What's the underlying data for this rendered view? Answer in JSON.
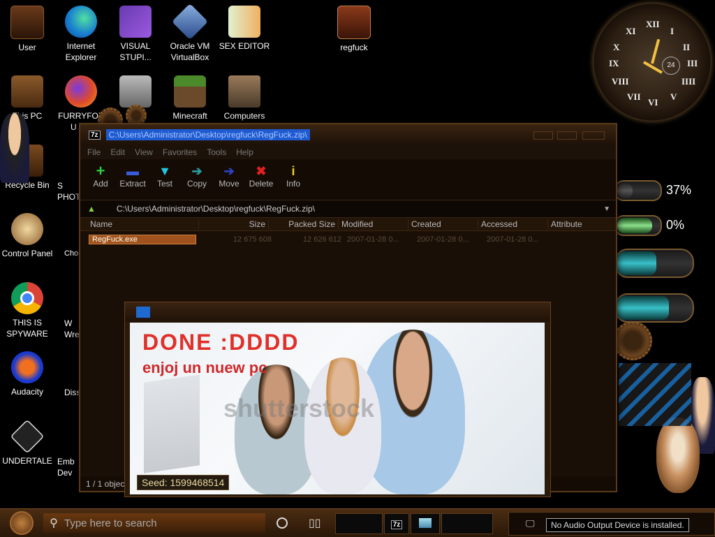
{
  "desktop": {
    "icons": [
      {
        "label": "User"
      },
      {
        "label": "Internet Explorer"
      },
      {
        "label": "VISUAL STUPI..."
      },
      {
        "label": "Oracle VM VirtualBox"
      },
      {
        "label": "SEX EDITOR"
      },
      {
        "label": "regfuck"
      },
      {
        "label": "This PC"
      },
      {
        "label": "FURRYFOX"
      },
      {
        "label": "Minecraft"
      },
      {
        "label": "Computers"
      },
      {
        "label": "Recycle Bin"
      },
      {
        "label": "Control Panel"
      },
      {
        "label": "THIS IS SPYWARE"
      },
      {
        "label": "Audacity"
      },
      {
        "label": "UNDERTALE"
      }
    ],
    "partial_labels": {
      "photo": "S PHOT",
      "chrome": "Chom",
      "wre": "W Wre",
      "dis": "Diss",
      "emb": "Emb Dev",
      "fox2": "U"
    }
  },
  "clock": {
    "numerals": [
      "XII",
      "I",
      "II",
      "III",
      "IIII",
      "V",
      "VI",
      "VII",
      "VIII",
      "IX",
      "X",
      "XI"
    ],
    "subdial": "24"
  },
  "window_7z": {
    "title": "C:\\Users\\Administrator\\Desktop\\regfuck\\RegFuck.zip\\",
    "app_badge": "7z",
    "menu": [
      "File",
      "Edit",
      "View",
      "Favorites",
      "Tools",
      "Help"
    ],
    "toolbar": [
      {
        "label": "Add",
        "glyph": "+",
        "color": "#2ecc40"
      },
      {
        "label": "Extract",
        "glyph": "▬",
        "color": "#3a5ad8"
      },
      {
        "label": "Test",
        "glyph": "▼",
        "color": "#22c8e0"
      },
      {
        "label": "Copy",
        "glyph": "➔",
        "color": "#2a9a9a"
      },
      {
        "label": "Move",
        "glyph": "➔",
        "color": "#3040c0"
      },
      {
        "label": "Delete",
        "glyph": "✖",
        "color": "#e02020"
      },
      {
        "label": "Info",
        "glyph": "i",
        "color": "#f0d020"
      }
    ],
    "address": "C:\\Users\\Administrator\\Desktop\\regfuck\\RegFuck.zip\\",
    "columns": [
      "Name",
      "Size",
      "Packed Size",
      "Modified",
      "Created",
      "Accessed",
      "Attribute"
    ],
    "files": [
      {
        "name": "RegFuck.exe",
        "size": "12 675 608",
        "packed": "12 626 612",
        "modified": "2007-01-28 0...",
        "created": "2007-01-28 0...",
        "accessed": "2007-01-28 0..."
      }
    ],
    "status": "1 / 1 objec"
  },
  "popup": {
    "headline": "DONE :DDDD",
    "subline": "enjoj un nuew pc",
    "watermark": "shutterstock",
    "seed_label": "Seed: 1599468514"
  },
  "widgets": {
    "cpu_percent": "37%",
    "mem_percent": "0%",
    "cpu_fill": 0.37,
    "mem_fill": 0.0
  },
  "taskbar": {
    "search_placeholder": "Type here to search",
    "pinned_badge": "7z",
    "tooltip": "No Audio Output Device is installed."
  }
}
